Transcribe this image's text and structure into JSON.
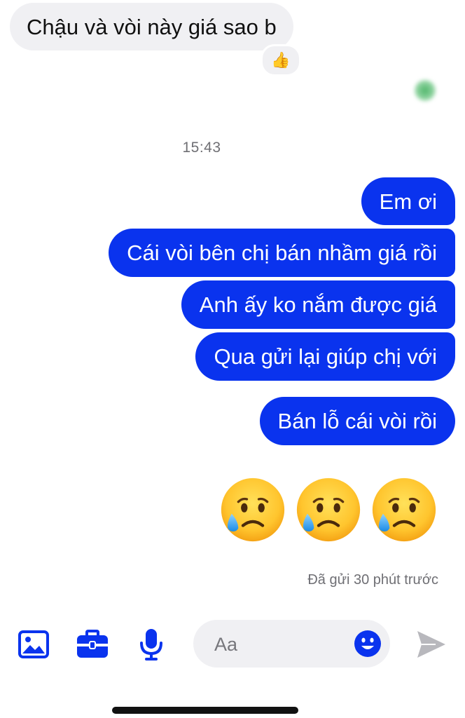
{
  "incoming": {
    "text": "Chậu và vòi này giá sao b",
    "reaction": "👍",
    "reaction_icon": "thumbs-up-icon"
  },
  "timestamp": "15:43",
  "outgoing": [
    "Em ơi",
    "Cái vòi bên chị bán nhầm giá rồi",
    "Anh ấy ko nắm được giá",
    "Qua gửi lại giúp chị với",
    "Bán lỗ cái vòi rồi"
  ],
  "emoji_message": {
    "icons": [
      "sad-but-relieved-face-icon",
      "sad-but-relieved-face-icon",
      "sad-but-relieved-face-icon"
    ]
  },
  "sent_status": "Đã gửi 30 phút trước",
  "toolbar": {
    "icons": [
      "photo-icon",
      "briefcase-icon",
      "microphone-icon"
    ],
    "placeholder": "Aa",
    "emoji_icon": "smiley-face-icon",
    "send_icon": "send-icon"
  },
  "colors": {
    "outgoing_bubble": "#0a33ee",
    "incoming_bubble": "#f0f0f3",
    "accent": "#0a33ee",
    "muted_text": "#6f6f74",
    "send_disabled": "#b8b8bd"
  }
}
